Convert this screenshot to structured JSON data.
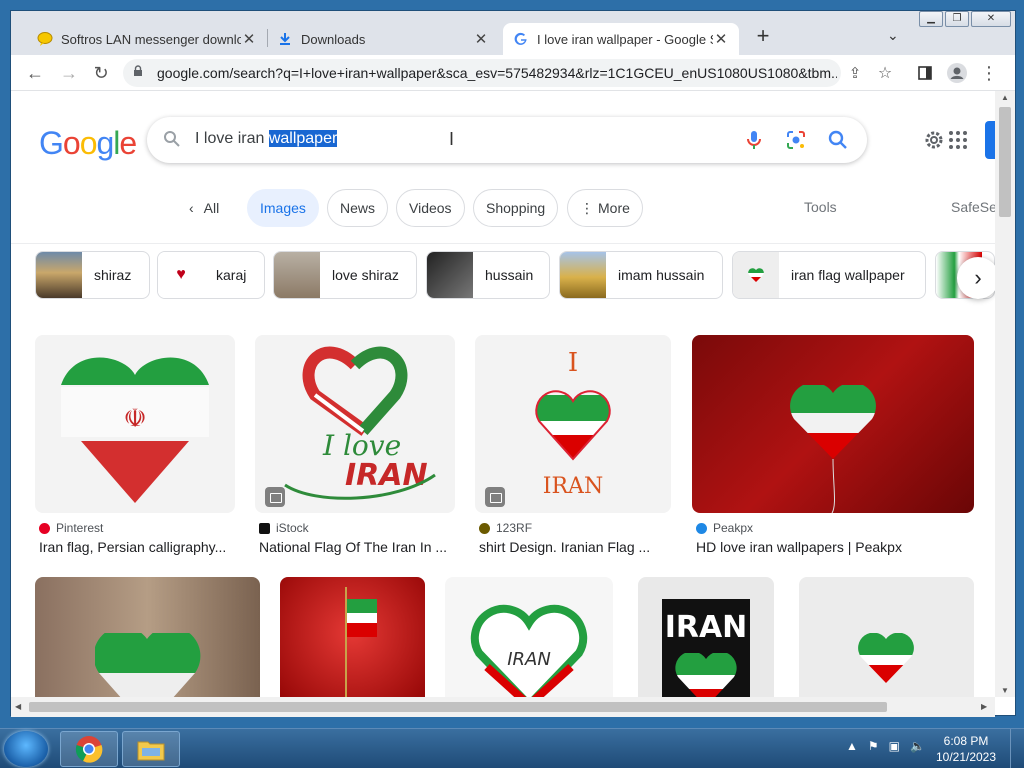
{
  "browser": {
    "tabs": [
      {
        "title": "Softros LAN messenger downloa",
        "icon": "softros-icon"
      },
      {
        "title": "Downloads",
        "icon": "download-icon"
      },
      {
        "title": "I love iran wallpaper - Google Se",
        "icon": "google-g-icon"
      }
    ],
    "url": "google.com/search?q=I+love+iran+wallpaper&sca_esv=575482934&rlz=1C1GCEU_enUS1080US1080&tbm..."
  },
  "search": {
    "query_plain": "I love iran ",
    "query_selected": "wallpaper"
  },
  "filters": {
    "all": "All",
    "items": [
      "Images",
      "News",
      "Videos",
      "Shopping",
      "More"
    ],
    "active": "Images",
    "tools": "Tools",
    "safesearch": "SafeSe"
  },
  "related": [
    "shiraz",
    "karaj",
    "love shiraz",
    "hussain",
    "imam hussain",
    "iran flag wallpaper"
  ],
  "results_row1": [
    {
      "source": "Pinterest",
      "caption": "Iran flag, Persian calligraphy..."
    },
    {
      "source": "iStock",
      "caption": "National Flag Of The Iran In ..."
    },
    {
      "source": "123RF",
      "caption": "shirt Design. Iranian Flag ..."
    },
    {
      "source": "Peakpx",
      "caption": "HD love iran wallpapers | Peakpx"
    }
  ],
  "image_text": {
    "ilove": "I love",
    "iran_caps": "IRAN",
    "iran_mixed": "IRAN",
    "letter_i": "I",
    "iran_heart": "IRAN",
    "iran_poster": "IRAN"
  },
  "taskbar": {
    "time": "6:08 PM",
    "date": "10/21/2023"
  },
  "colors": {
    "google_blue": "#1a73e8",
    "iran_green": "#239f40",
    "iran_red": "#da0000",
    "selection": "#1967d2"
  }
}
